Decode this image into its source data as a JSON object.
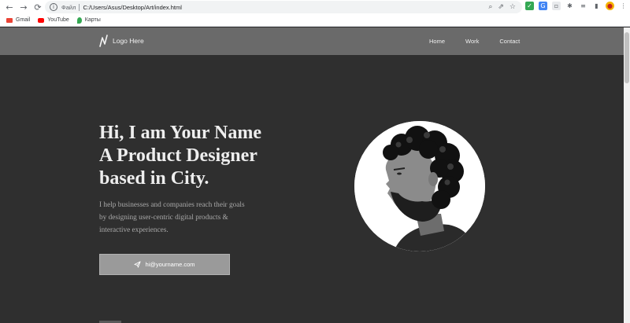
{
  "browser": {
    "nav": {
      "back": "←",
      "forward": "→",
      "reload": "⟳"
    },
    "address": {
      "info_icon": "i",
      "scheme_label": "Файл",
      "url": "C:/Users/Asus/Desktop/Art/index.html"
    },
    "address_actions": [
      "search-icon",
      "share-icon",
      "star-icon"
    ],
    "bookmarks": [
      {
        "label": "Gmail",
        "icon": "gmail-icon",
        "color": "#ea4335"
      },
      {
        "label": "YouTube",
        "icon": "youtube-icon",
        "color": "#ff0000"
      },
      {
        "label": "Карты",
        "icon": "maps-icon",
        "color": "#34a853"
      }
    ]
  },
  "site": {
    "logo_text": "Logo Here",
    "menu": [
      "Home",
      "Work",
      "Contact"
    ],
    "hero": {
      "title_lines": [
        "Hi, I am Your Name",
        "A Product Designer",
        "based in City."
      ],
      "description": "I help businesses and companies reach their goals by designing user-centric digital products & interactive experiences.",
      "email_button": "hi@yourname.com"
    }
  },
  "colors": {
    "nav_bg": "#6a6a6a",
    "page_bg": "#2f2f2f",
    "button_bg": "#9a9a9a",
    "title_text": "#eeeeee"
  }
}
